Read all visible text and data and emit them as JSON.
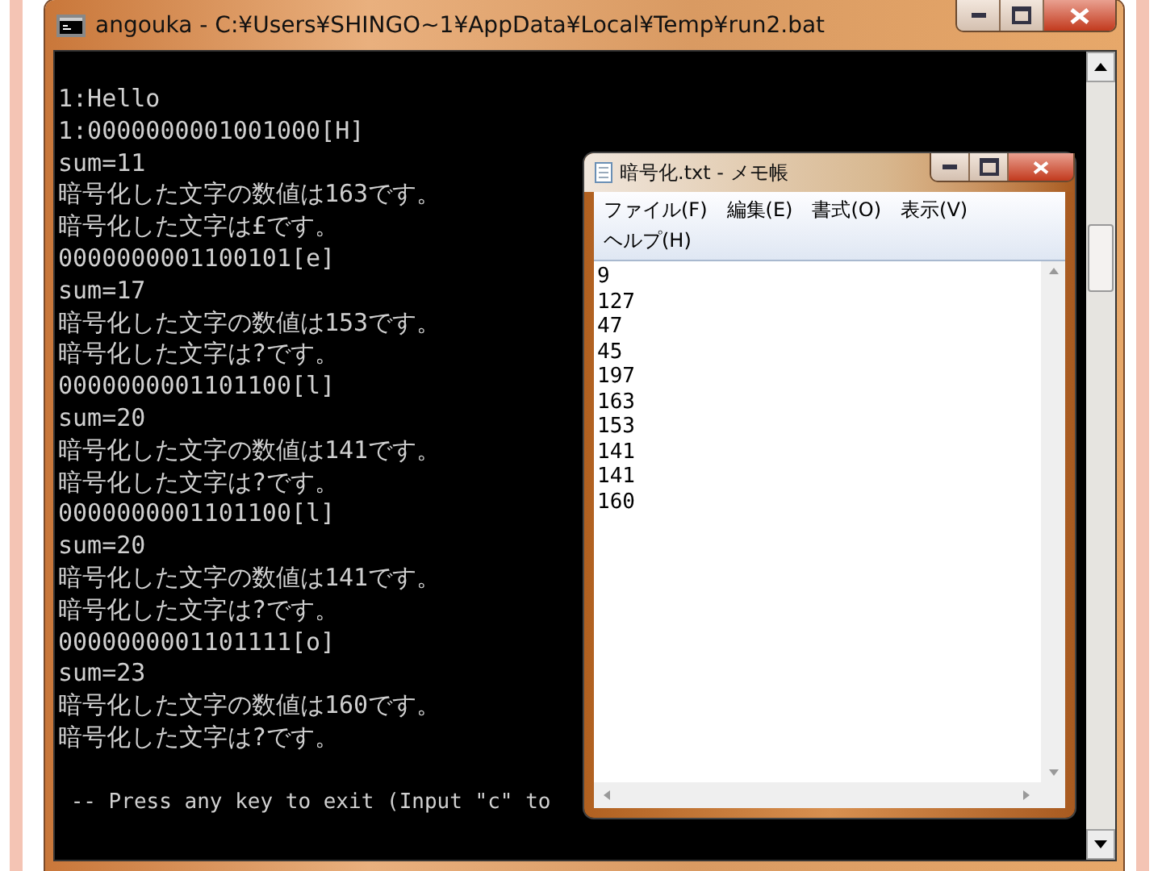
{
  "console_window": {
    "title": "angouka - C:¥Users¥SHINGO~1¥AppData¥Local¥Temp¥run2.bat",
    "lines": [
      "1:Hello",
      "1:0000000001001000[H]",
      "sum=11",
      "暗号化した文字の数値は163です。",
      "暗号化した文字は£です。",
      "0000000001100101[e]",
      "sum=17",
      "暗号化した文字の数値は153です。",
      "暗号化した文字は?です。",
      "0000000001101100[l]",
      "sum=20",
      "暗号化した文字の数値は141です。",
      "暗号化した文字は?です。",
      "0000000001101100[l]",
      "sum=20",
      "暗号化した文字の数値は141です。",
      "暗号化した文字は?です。",
      "0000000001101111[o]",
      "sum=23",
      "暗号化した文字の数値は160です。",
      "暗号化した文字は?です。"
    ],
    "prompt": " -- Press any key to exit (Input \"c\" to"
  },
  "notepad_window": {
    "title": "暗号化.txt - メモ帳",
    "menu": [
      "ファイル(F)",
      "編集(E)",
      "書式(O)",
      "表示(V)",
      "ヘルプ(H)"
    ],
    "lines": [
      "9",
      "127",
      "47",
      "45",
      "197",
      "163",
      "153",
      "141",
      "141",
      "160"
    ]
  }
}
